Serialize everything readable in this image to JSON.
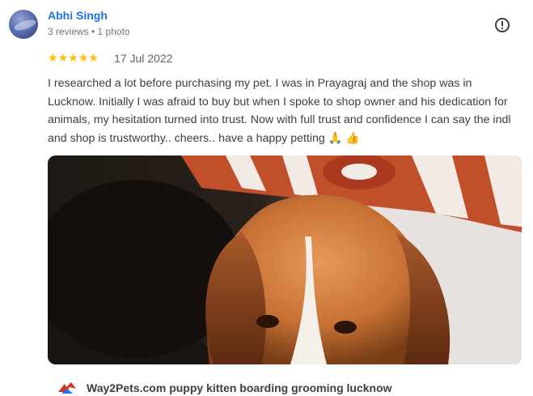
{
  "reviewer": {
    "name": "Abhi Singh",
    "meta": "3 reviews • 1 photo"
  },
  "rating": {
    "stars": 5,
    "date": "17 Jul 2022"
  },
  "review": {
    "text": "I researched a lot before purchasing my pet. I was in Prayagraj and the shop was in Lucknow. Initially I was afraid to buy but when I spoke to shop owner and his dedication for animals, my hesitation turned into trust. Now with full trust and confidence I can say the indl and shop is trustworthy.. cheers.. have a happy petting 🙏 👍"
  },
  "store": {
    "name": "Way2Pets.com puppy kitten boarding grooming lucknow"
  },
  "icons": {
    "report": "report-icon",
    "star": "star-icon",
    "store_logo": "way2pets-logo-icon"
  },
  "colors": {
    "link": "#1a73e8",
    "star": "#fbbc04"
  }
}
